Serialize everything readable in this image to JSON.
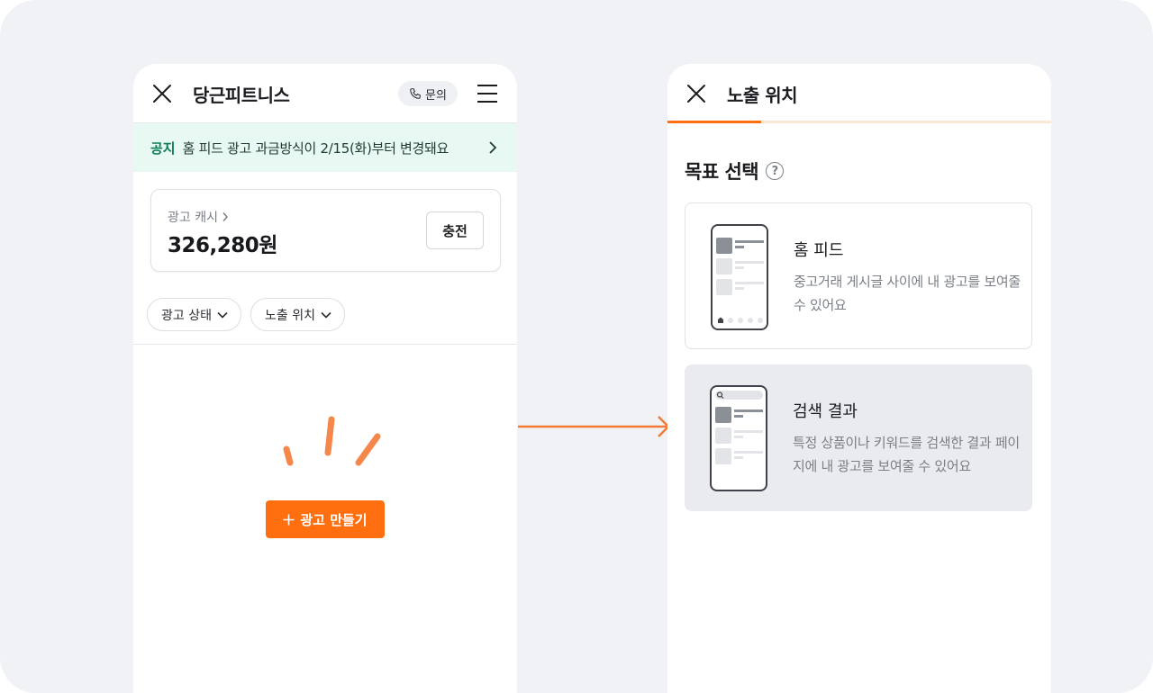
{
  "colors": {
    "brand": "#ff6f0f",
    "notice_bg": "#e8f8f2",
    "notice_tag": "#0c7c5a"
  },
  "left": {
    "app_title": "당근피트니스",
    "inquiry_label": "문의",
    "notice": {
      "tag": "공지",
      "message": "홈 피드 광고 과금방식이 2/15(화)부터 변경돼요"
    },
    "cash": {
      "label": "광고 캐시",
      "amount": "326,280원",
      "charge_label": "충전"
    },
    "filters": [
      {
        "label": "광고 상태"
      },
      {
        "label": "노출 위치"
      }
    ],
    "create_label": "광고 만들기"
  },
  "right": {
    "title": "노출 위치",
    "goal_title": "목표 선택",
    "help_mark": "?",
    "options": [
      {
        "title": "홈 피드",
        "desc": "중고거래 게시글 사이에 내 광고를 보여줄 수 있어요",
        "selected": false
      },
      {
        "title": "검색 결과",
        "desc": "특정 상품이나 키워드를 검색한 결과 페이지에 내 광고를 보여줄 수 있어요",
        "selected": true
      }
    ]
  },
  "icons": [
    "close-icon",
    "phone-icon",
    "hamburger-menu-icon",
    "chevron-right-icon",
    "chevron-down-icon",
    "plus-icon",
    "help-icon",
    "home-icon",
    "search-icon",
    "arrow-right-icon"
  ]
}
